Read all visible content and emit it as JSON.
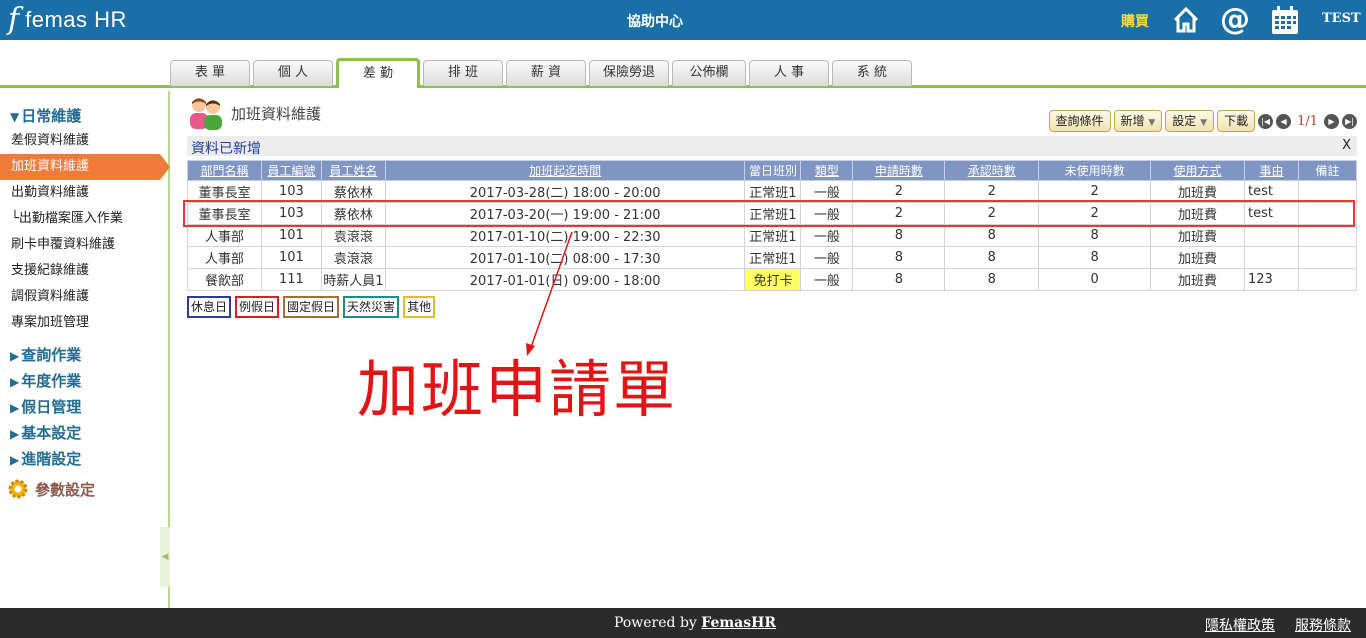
{
  "header": {
    "logo_mark": "f",
    "logo_text": "femas HR",
    "help_center": "協助中心",
    "buy_label": "購買",
    "user": "TEST"
  },
  "tabs": [
    {
      "label": "表 單"
    },
    {
      "label": "個 人"
    },
    {
      "label": "差 勤"
    },
    {
      "label": "排 班"
    },
    {
      "label": "薪 資"
    },
    {
      "label": "保險勞退"
    },
    {
      "label": "公佈欄"
    },
    {
      "label": "人 事"
    },
    {
      "label": "系 統"
    }
  ],
  "sidebar": {
    "section_daily": "日常維護",
    "items": [
      {
        "label": "差假資料維護"
      },
      {
        "label": "加班資料維護"
      },
      {
        "label": "出勤資料維護"
      },
      {
        "label": "└出勤檔案匯入作業"
      },
      {
        "label": "刷卡申覆資料維護"
      },
      {
        "label": "支援紀錄維護"
      },
      {
        "label": "調假資料維護"
      },
      {
        "label": "專案加班管理"
      }
    ],
    "sections": [
      {
        "label": "查詢作業"
      },
      {
        "label": "年度作業"
      },
      {
        "label": "假日管理"
      },
      {
        "label": "基本設定"
      },
      {
        "label": "進階設定"
      }
    ],
    "params": "參數設定"
  },
  "main": {
    "title": "加班資料維護",
    "toolbar": {
      "query": "查詢條件",
      "add": "新增",
      "settings": "設定",
      "download": "下載",
      "page": "1/1"
    },
    "notice": "資料已新增",
    "notice_close": "X",
    "columns": [
      "部門名稱",
      "員工編號",
      "員工姓名",
      "加班起迄時間",
      "當日班別",
      "類型",
      "申請時數",
      "承認時數",
      "未使用時數",
      "使用方式",
      "事由",
      "備註"
    ],
    "rows": [
      [
        "董事長室",
        "103",
        "蔡依林",
        "2017-03-28(二) 18:00 - 20:00",
        "正常班1",
        "一般",
        "2",
        "2",
        "2",
        "加班費",
        "test",
        ""
      ],
      [
        "董事長室",
        "103",
        "蔡依林",
        "2017-03-20(一) 19:00 - 21:00",
        "正常班1",
        "一般",
        "2",
        "2",
        "2",
        "加班費",
        "test",
        ""
      ],
      [
        "人事部",
        "101",
        "袁滾滾",
        "2017-01-10(二) 19:00 - 22:30",
        "正常班1",
        "一般",
        "8",
        "8",
        "8",
        "加班費",
        "",
        ""
      ],
      [
        "人事部",
        "101",
        "袁滾滾",
        "2017-01-10(二) 08:00 - 17:30",
        "正常班1",
        "一般",
        "8",
        "8",
        "8",
        "加班費",
        "",
        ""
      ],
      [
        "餐飲部",
        "111",
        "時薪人員1",
        "2017-01-01(日) 09:00 - 18:00",
        "免打卡",
        "一般",
        "8",
        "8",
        "0",
        "加班費",
        "123",
        ""
      ]
    ],
    "legend": [
      {
        "label": "休息日",
        "color": "#2a3f8f"
      },
      {
        "label": "例假日",
        "color": "#d42020"
      },
      {
        "label": "國定假日",
        "color": "#a0703a"
      },
      {
        "label": "天然災害",
        "color": "#1f8a8a"
      },
      {
        "label": "其他",
        "color": "#e0c020"
      }
    ],
    "annotation": "加班申請單"
  },
  "footer": {
    "powered_prefix": "Powered by",
    "powered_link": "FemasHR",
    "privacy": "隱私權政策",
    "terms": "服務條款"
  },
  "colors": {
    "topbar": "#1a6fa8",
    "accent_green": "#8fc14a",
    "active_item": "#f07a3a",
    "table_header": "#7f95c4",
    "annotation_red": "#e01515"
  }
}
